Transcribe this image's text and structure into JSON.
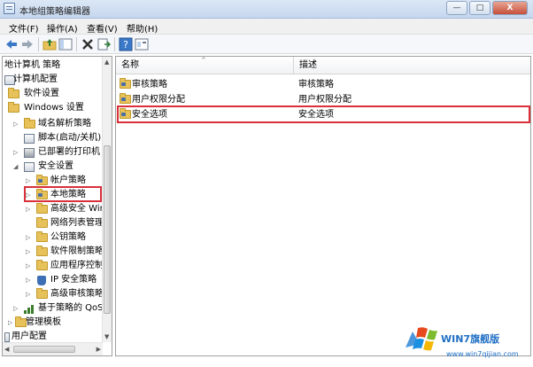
{
  "window": {
    "title": "本地组策略编辑器",
    "min": "—",
    "max": "□",
    "close": "X"
  },
  "menu": [
    "文件(F)",
    "操作(A)",
    "查看(V)",
    "帮助(H)"
  ],
  "tree": {
    "root": "地计算机 策略",
    "computer_config": "计算机配置",
    "software_settings": "软件设置",
    "windows_settings": "Windows 设置",
    "dns": "域名解析策略",
    "scripts": "脚本(启动/关机)",
    "printers": "已部署的打印机",
    "security_settings": "安全设置",
    "account_policies": "帐户策略",
    "local_policies": "本地策略",
    "advanced_firewall": "高级安全 Wir",
    "network_list": "网络列表管理",
    "public_key": "公钥策略",
    "software_restriction": "软件限制策略",
    "app_control": "应用程序控制",
    "ip_security": "IP 安全策略",
    "advanced_audit": "高级审核策略",
    "qos": "基于策略的 QoS",
    "admin_templates": "管理模板",
    "user_config": "用户配置"
  },
  "list": {
    "col_name": "名称",
    "col_desc": "描述",
    "rows": [
      {
        "name": "审核策略",
        "desc": "审核策略"
      },
      {
        "name": "用户权限分配",
        "desc": "用户权限分配"
      },
      {
        "name": "安全选项",
        "desc": "安全选项"
      }
    ]
  },
  "watermark": {
    "brand": "WIN7旗舰版",
    "url": "www.win7qijian.com"
  },
  "colors": {
    "highlight": "#d9303a",
    "folder": "#e7c25a",
    "brand": "#1f6fc4"
  }
}
